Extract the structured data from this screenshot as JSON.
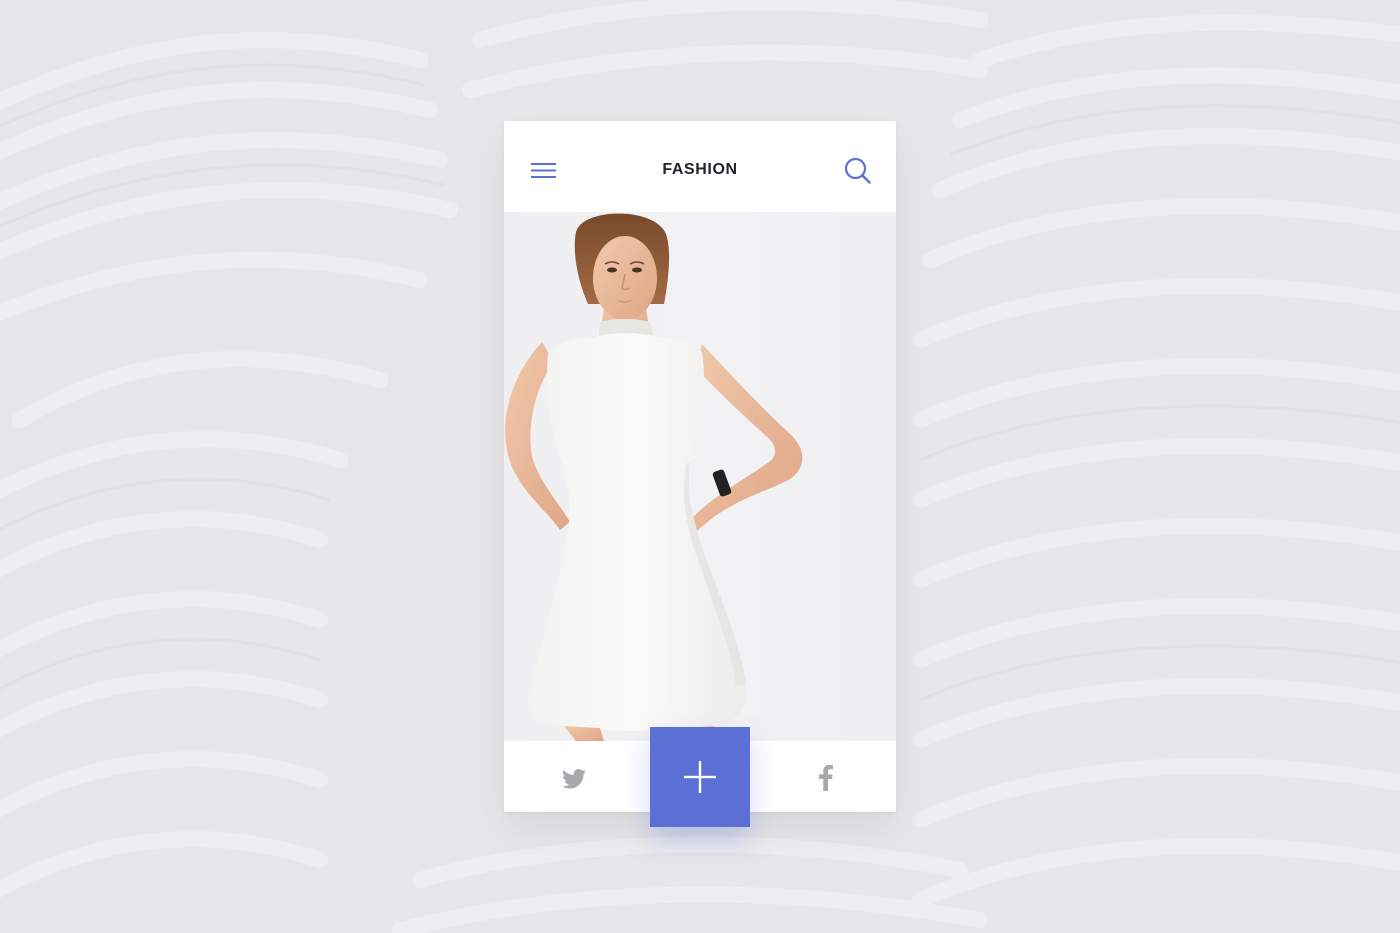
{
  "header": {
    "title": "FASHION",
    "menu_icon": "hamburger-menu-icon",
    "search_icon": "search-icon"
  },
  "hero": {
    "image": "model-white-sleeveless-dress-photo"
  },
  "bottom_bar": {
    "left_icon": "twitter-icon",
    "right_icon": "facebook-icon",
    "fab_icon": "plus-icon"
  },
  "colors": {
    "accent": "#5b6fd4",
    "icon_grey": "#a8a8ad",
    "title": "#23232b",
    "background": "#e7e7e9"
  }
}
